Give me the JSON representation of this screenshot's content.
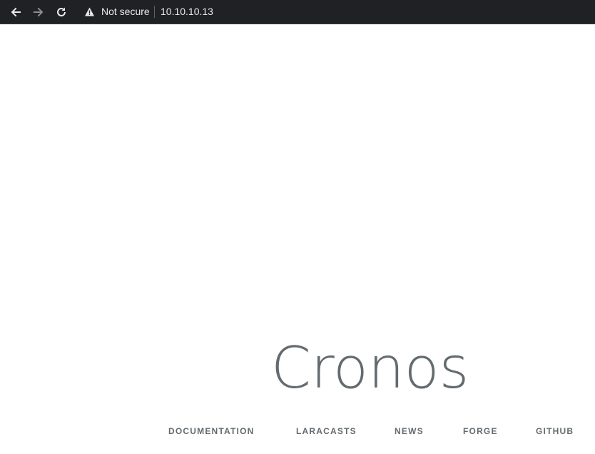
{
  "browser": {
    "security_label": "Not secure",
    "url": "10.10.10.13",
    "icons": {
      "back": "back-arrow-icon",
      "forward": "forward-arrow-icon",
      "reload": "reload-icon",
      "security": "warning-triangle-icon"
    }
  },
  "page": {
    "title": "Cronos",
    "links": [
      "DOCUMENTATION",
      "LARACASTS",
      "NEWS",
      "FORGE",
      "GITHUB"
    ]
  },
  "colors": {
    "toolbar_bg": "#202124",
    "toolbar_text": "#e8eaed",
    "page_text": "#636b6f",
    "page_bg": "#ffffff"
  }
}
